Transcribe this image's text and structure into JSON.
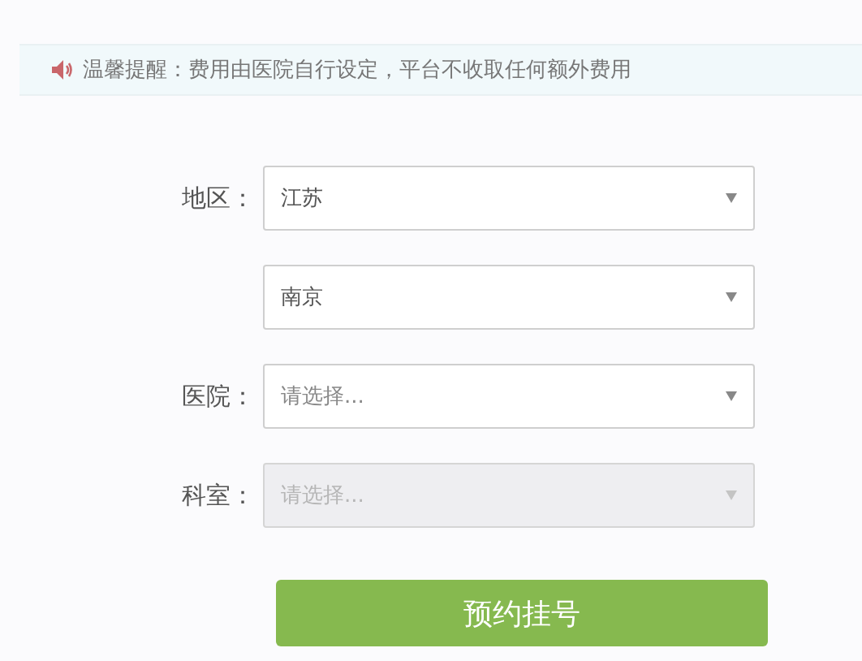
{
  "notice": {
    "text": "温馨提醒：费用由医院自行设定，平台不收取任何额外费用"
  },
  "fields": [
    {
      "label": "地区：",
      "value": "江苏",
      "disabled": false
    },
    {
      "value": "南京",
      "disabled": false
    },
    {
      "label": "医院：",
      "placeholder": "请选择...",
      "disabled": false
    },
    {
      "label": "科室：",
      "placeholder": "请选择...",
      "disabled": true
    }
  ],
  "submit": {
    "label": "预约挂号"
  }
}
